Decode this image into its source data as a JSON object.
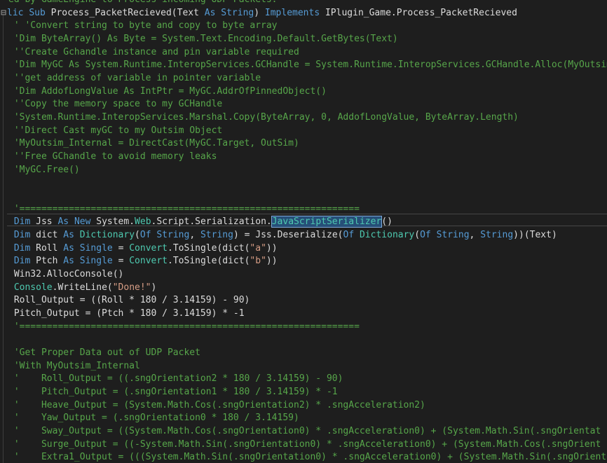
{
  "editor": {
    "lines": [
      {
        "fold": false,
        "tokens": [
          {
            "t": "ed by GameEngine to Process incoming UDP Packets.",
            "c": "comment"
          }
        ]
      },
      {
        "fold": true,
        "tokens": [
          {
            "t": "lic ",
            "c": "kw"
          },
          {
            "t": "Sub ",
            "c": "kw"
          },
          {
            "t": "Process_PacketRecieved(Text ",
            "c": "text"
          },
          {
            "t": "As ",
            "c": "kw"
          },
          {
            "t": "String",
            "c": "kw"
          },
          {
            "t": ") ",
            "c": "text"
          },
          {
            "t": "Implements ",
            "c": "kw"
          },
          {
            "t": "IPlugin_Game.Process_PacketRecieved",
            "c": "text"
          }
        ]
      },
      {
        "fold": false,
        "tokens": [
          {
            "t": " ' 'Convert string to byte and copy to byte array",
            "c": "comment"
          }
        ]
      },
      {
        "fold": false,
        "tokens": [
          {
            "t": " 'Dim ByteArray() As Byte = System.Text.Encoding.Default.GetBytes(Text)",
            "c": "comment"
          }
        ]
      },
      {
        "fold": false,
        "tokens": [
          {
            "t": " ''Create Gchandle instance and pin variable required",
            "c": "comment"
          }
        ]
      },
      {
        "fold": false,
        "tokens": [
          {
            "t": " 'Dim MyGC As System.Runtime.InteropServices.GCHandle = System.Runtime.InteropServices.GCHandle.Alloc(MyOutsim",
            "c": "comment"
          }
        ]
      },
      {
        "fold": false,
        "tokens": [
          {
            "t": " ''get address of variable in pointer variable",
            "c": "comment"
          }
        ]
      },
      {
        "fold": false,
        "tokens": [
          {
            "t": " 'Dim AddofLongValue As IntPtr = MyGC.AddrOfPinnedObject()",
            "c": "comment"
          }
        ]
      },
      {
        "fold": false,
        "tokens": [
          {
            "t": " ''Copy the memory space to my GCHandle",
            "c": "comment"
          }
        ]
      },
      {
        "fold": false,
        "tokens": [
          {
            "t": " 'System.Runtime.InteropServices.Marshal.Copy(ByteArray, 0, AddofLongValue, ByteArray.Length)",
            "c": "comment"
          }
        ]
      },
      {
        "fold": false,
        "tokens": [
          {
            "t": " ''Direct Cast myGC to my Outsim Object",
            "c": "comment"
          }
        ]
      },
      {
        "fold": false,
        "tokens": [
          {
            "t": " 'MyOutsim_Internal = DirectCast(MyGC.Target, OutSim)",
            "c": "comment"
          }
        ]
      },
      {
        "fold": false,
        "tokens": [
          {
            "t": " ''Free GChandle to avoid memory leaks",
            "c": "comment"
          }
        ]
      },
      {
        "fold": false,
        "tokens": [
          {
            "t": " 'MyGC.Free()",
            "c": "comment"
          }
        ]
      },
      {
        "fold": false,
        "tokens": []
      },
      {
        "fold": false,
        "tokens": []
      },
      {
        "fold": false,
        "tokens": [
          {
            "t": " '==============================================================",
            "c": "comment"
          }
        ]
      },
      {
        "fold": false,
        "tokens": [
          {
            "t": " Dim ",
            "c": "kw"
          },
          {
            "t": "Jss ",
            "c": "text"
          },
          {
            "t": "As ",
            "c": "kw"
          },
          {
            "t": "New ",
            "c": "kw"
          },
          {
            "t": "System.",
            "c": "text"
          },
          {
            "t": "Web",
            "c": "type"
          },
          {
            "t": ".Script.Serialization.",
            "c": "text"
          },
          {
            "t": "JavaScriptSerializer",
            "c": "sel"
          },
          {
            "t": "()",
            "c": "text"
          }
        ]
      },
      {
        "fold": false,
        "tokens": [
          {
            "t": " Dim ",
            "c": "kw"
          },
          {
            "t": "dict ",
            "c": "text"
          },
          {
            "t": "As ",
            "c": "kw"
          },
          {
            "t": "Dictionary",
            "c": "type"
          },
          {
            "t": "(",
            "c": "text"
          },
          {
            "t": "Of ",
            "c": "kw"
          },
          {
            "t": "String",
            "c": "kw"
          },
          {
            "t": ", ",
            "c": "text"
          },
          {
            "t": "String",
            "c": "kw"
          },
          {
            "t": ") = Jss.Deserialize(",
            "c": "text"
          },
          {
            "t": "Of ",
            "c": "kw"
          },
          {
            "t": "Dictionary",
            "c": "type"
          },
          {
            "t": "(",
            "c": "text"
          },
          {
            "t": "Of ",
            "c": "kw"
          },
          {
            "t": "String",
            "c": "kw"
          },
          {
            "t": ", ",
            "c": "text"
          },
          {
            "t": "String",
            "c": "kw"
          },
          {
            "t": "))(Text)",
            "c": "text"
          }
        ]
      },
      {
        "fold": false,
        "tokens": [
          {
            "t": " Dim ",
            "c": "kw"
          },
          {
            "t": "Roll ",
            "c": "text"
          },
          {
            "t": "As ",
            "c": "kw"
          },
          {
            "t": "Single ",
            "c": "kw"
          },
          {
            "t": "= ",
            "c": "text"
          },
          {
            "t": "Convert",
            "c": "type"
          },
          {
            "t": ".ToSingle(dict(",
            "c": "text"
          },
          {
            "t": "\"a\"",
            "c": "str"
          },
          {
            "t": "))",
            "c": "text"
          }
        ]
      },
      {
        "fold": false,
        "tokens": [
          {
            "t": " Dim ",
            "c": "kw"
          },
          {
            "t": "Ptch ",
            "c": "text"
          },
          {
            "t": "As ",
            "c": "kw"
          },
          {
            "t": "Single ",
            "c": "kw"
          },
          {
            "t": "= ",
            "c": "text"
          },
          {
            "t": "Convert",
            "c": "type"
          },
          {
            "t": ".ToSingle(dict(",
            "c": "text"
          },
          {
            "t": "\"b\"",
            "c": "str"
          },
          {
            "t": "))",
            "c": "text"
          }
        ]
      },
      {
        "fold": false,
        "tokens": [
          {
            "t": " Win32.AllocConsole()",
            "c": "text"
          }
        ]
      },
      {
        "fold": false,
        "tokens": [
          {
            "t": " ",
            "c": "text"
          },
          {
            "t": "Console",
            "c": "type"
          },
          {
            "t": ".WriteLine(",
            "c": "text"
          },
          {
            "t": "\"Done!\"",
            "c": "str"
          },
          {
            "t": ")",
            "c": "text"
          }
        ]
      },
      {
        "fold": false,
        "tokens": [
          {
            "t": " Roll_Output = ((Roll * 180 / 3.14159) - 90)",
            "c": "text"
          }
        ]
      },
      {
        "fold": false,
        "tokens": [
          {
            "t": " Pitch_Output = (Ptch * 180 / 3.14159) * -1",
            "c": "text"
          }
        ]
      },
      {
        "fold": false,
        "tokens": [
          {
            "t": " '==============================================================",
            "c": "comment"
          }
        ]
      },
      {
        "fold": false,
        "tokens": []
      },
      {
        "fold": false,
        "tokens": [
          {
            "t": " 'Get Proper Data out of UDP Packet",
            "c": "comment"
          }
        ]
      },
      {
        "fold": false,
        "tokens": [
          {
            "t": " 'With MyOutsim_Internal",
            "c": "comment"
          }
        ]
      },
      {
        "fold": false,
        "tokens": [
          {
            "t": " '    Roll_Output = ((.sngOrientation2 * 180 / 3.14159) - 90)",
            "c": "comment"
          }
        ]
      },
      {
        "fold": false,
        "tokens": [
          {
            "t": " '    Pitch_Output = (.sngOrientation1 * 180 / 3.14159) * -1",
            "c": "comment"
          }
        ]
      },
      {
        "fold": false,
        "tokens": [
          {
            "t": " '    Heave_Output = (System.Math.Cos(.sngOrientation2) * .sngAcceleration2)",
            "c": "comment"
          }
        ]
      },
      {
        "fold": false,
        "tokens": [
          {
            "t": " '    Yaw_Output = (.sngOrientation0 * 180 / 3.14159)",
            "c": "comment"
          }
        ]
      },
      {
        "fold": false,
        "tokens": [
          {
            "t": " '    Sway_Output = ((System.Math.Cos(.sngOrientation0) * .sngAcceleration0) + (System.Math.Sin(.sngOrientat",
            "c": "comment"
          }
        ]
      },
      {
        "fold": false,
        "tokens": [
          {
            "t": " '    Surge_Output = ((-System.Math.Sin(.sngOrientation0) * .sngAcceleration0) + (System.Math.Cos(.sngOrient",
            "c": "comment"
          }
        ]
      },
      {
        "fold": false,
        "tokens": [
          {
            "t": " '    Extra1_Output = (((System.Math.Sin(.sngOrientation0) * .sngAcceleration0) + (System.Math.Sin(.sngOrient",
            "c": "comment"
          }
        ]
      }
    ],
    "fold_marker": "⊟",
    "colors": {
      "background": "#1e1e1e",
      "keyword": "#569cd6",
      "type": "#4ec9b0",
      "comment": "#57a64a",
      "string": "#d69d85",
      "text": "#dcdcdc",
      "selection": "#264f78"
    }
  }
}
